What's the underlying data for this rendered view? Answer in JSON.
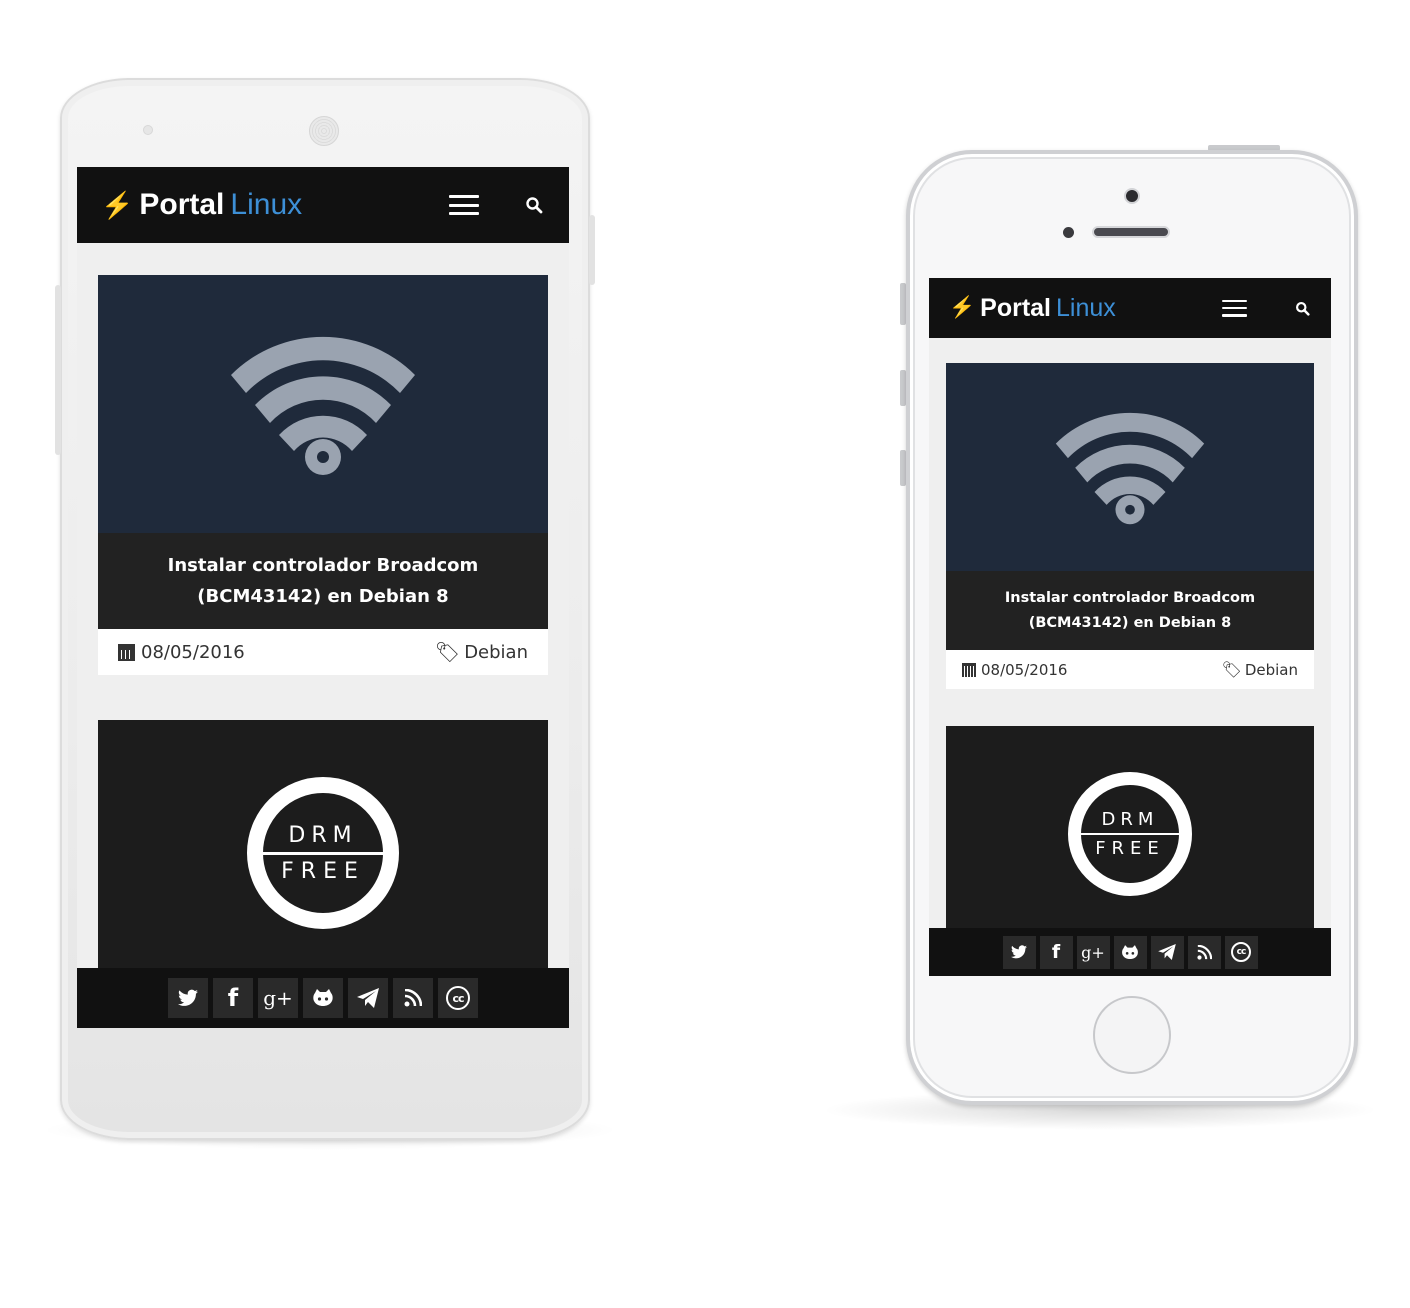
{
  "site": {
    "logo_bolt": "⚡",
    "logo_word1": "Portal",
    "logo_word2": "Linux",
    "brand_color": "#3d8fd6",
    "menu_icon": "hamburger-menu-icon",
    "search_icon": "search-icon",
    "search_glyph": "⌕"
  },
  "posts": [
    {
      "title": "Instalar controlador Broadcom (BCM43142) en Debian 8",
      "date": "08/05/2016",
      "tag": "Debian",
      "image": "wifi-icon"
    },
    {
      "image": "drm-free-logo",
      "logo_top": "DRM",
      "logo_bottom": "FREE"
    }
  ],
  "social": [
    {
      "name": "twitter-icon",
      "glyph": "🐦"
    },
    {
      "name": "facebook-icon",
      "glyph": "f"
    },
    {
      "name": "google-plus-icon",
      "glyph": "g+"
    },
    {
      "name": "github-icon",
      "glyph": "🐱"
    },
    {
      "name": "telegram-icon",
      "glyph": "➤"
    },
    {
      "name": "rss-icon",
      "glyph": "◉"
    },
    {
      "name": "creative-commons-icon",
      "glyph": "cc"
    }
  ]
}
